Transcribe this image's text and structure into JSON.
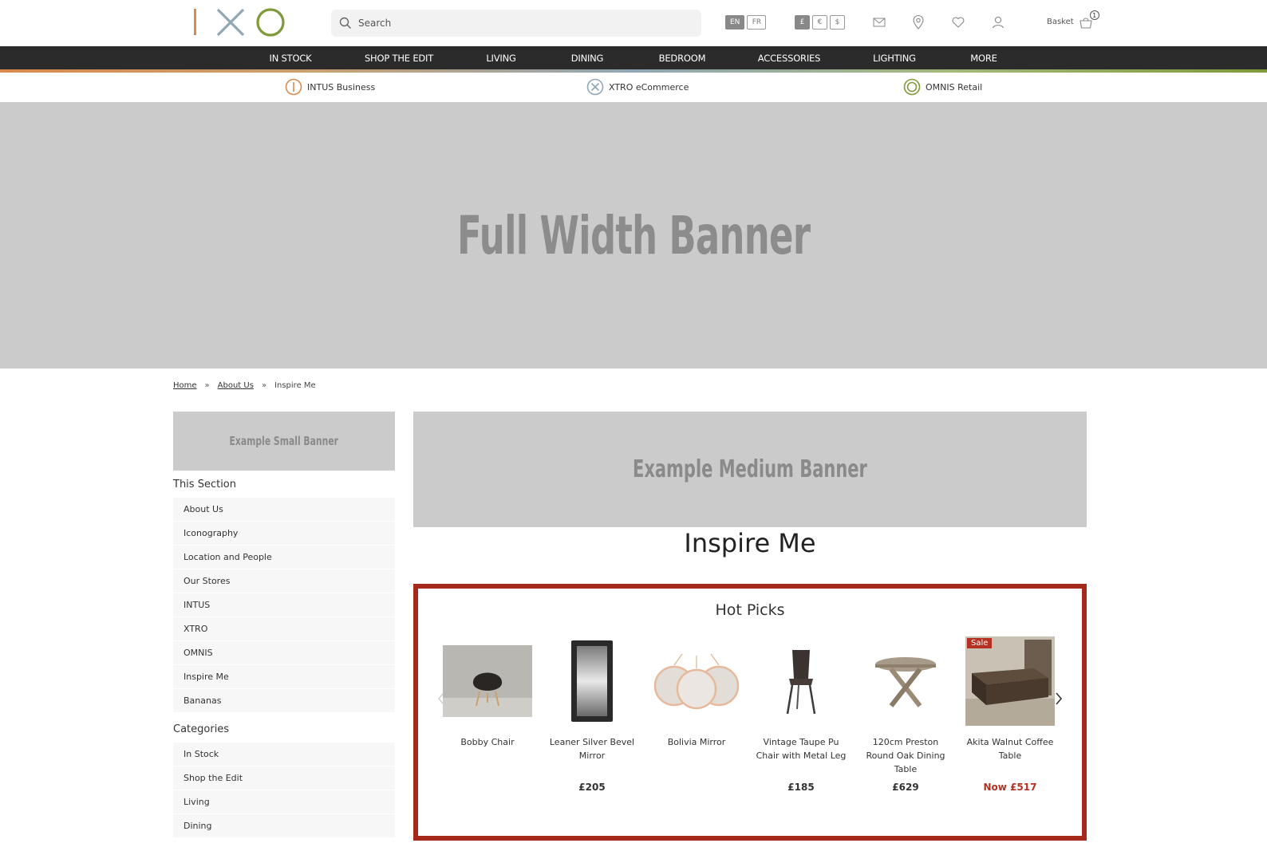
{
  "header": {
    "search_placeholder": "Search",
    "languages": [
      "EN",
      "FR"
    ],
    "active_language": "EN",
    "currencies": [
      "£",
      "€",
      "$"
    ],
    "active_currency": "£",
    "basket_label": "Basket",
    "basket_count": "1"
  },
  "nav": {
    "items": [
      "IN STOCK",
      "SHOP THE EDIT",
      "LIVING",
      "DINING",
      "BEDROOM",
      "ACCESSORIES",
      "LIGHTING",
      "MORE"
    ]
  },
  "brands": [
    {
      "label": "INTUS Business",
      "color": "#d98a4d"
    },
    {
      "label": "XTRO eCommerce",
      "color": "#8fa7b6"
    },
    {
      "label": "OMNIS Retail",
      "color": "#7f9a3a"
    }
  ],
  "hero": {
    "text": "Full Width Banner"
  },
  "breadcrumb": {
    "items": [
      "Home",
      "About Us",
      "Inspire Me"
    ],
    "separator": "»"
  },
  "sidebar": {
    "small_banner": "Example Small Banner",
    "section_heading": "This Section",
    "section_items": [
      "About Us",
      "Iconography",
      "Location and People",
      "Our Stores",
      "INTUS",
      "XTRO",
      "OMNIS",
      "Inspire Me",
      "Bananas"
    ],
    "categories_heading": "Categories",
    "category_items": [
      "In Stock",
      "Shop the Edit",
      "Living",
      "Dining"
    ]
  },
  "main": {
    "medium_banner": "Example Medium Banner",
    "title": "Inspire Me",
    "hot_picks": {
      "title": "Hot Picks",
      "products": [
        {
          "name": "Bobby Chair",
          "price": ""
        },
        {
          "name": "Leaner Silver Bevel Mirror",
          "price": "£205"
        },
        {
          "name": "Bolivia Mirror",
          "price": ""
        },
        {
          "name": "Vintage Taupe Pu Chair with Metal Leg",
          "price": "£185"
        },
        {
          "name": "120cm Preston Round Oak Dining Table",
          "price": "£629"
        },
        {
          "name": "Akita Walnut Coffee Table",
          "price": "Now £517",
          "badge": "Sale"
        }
      ]
    }
  },
  "colors": {
    "accent_red": "#a52a1c",
    "nav_bg": "#2b2b2b",
    "banner_bg": "#cbcbcb"
  }
}
